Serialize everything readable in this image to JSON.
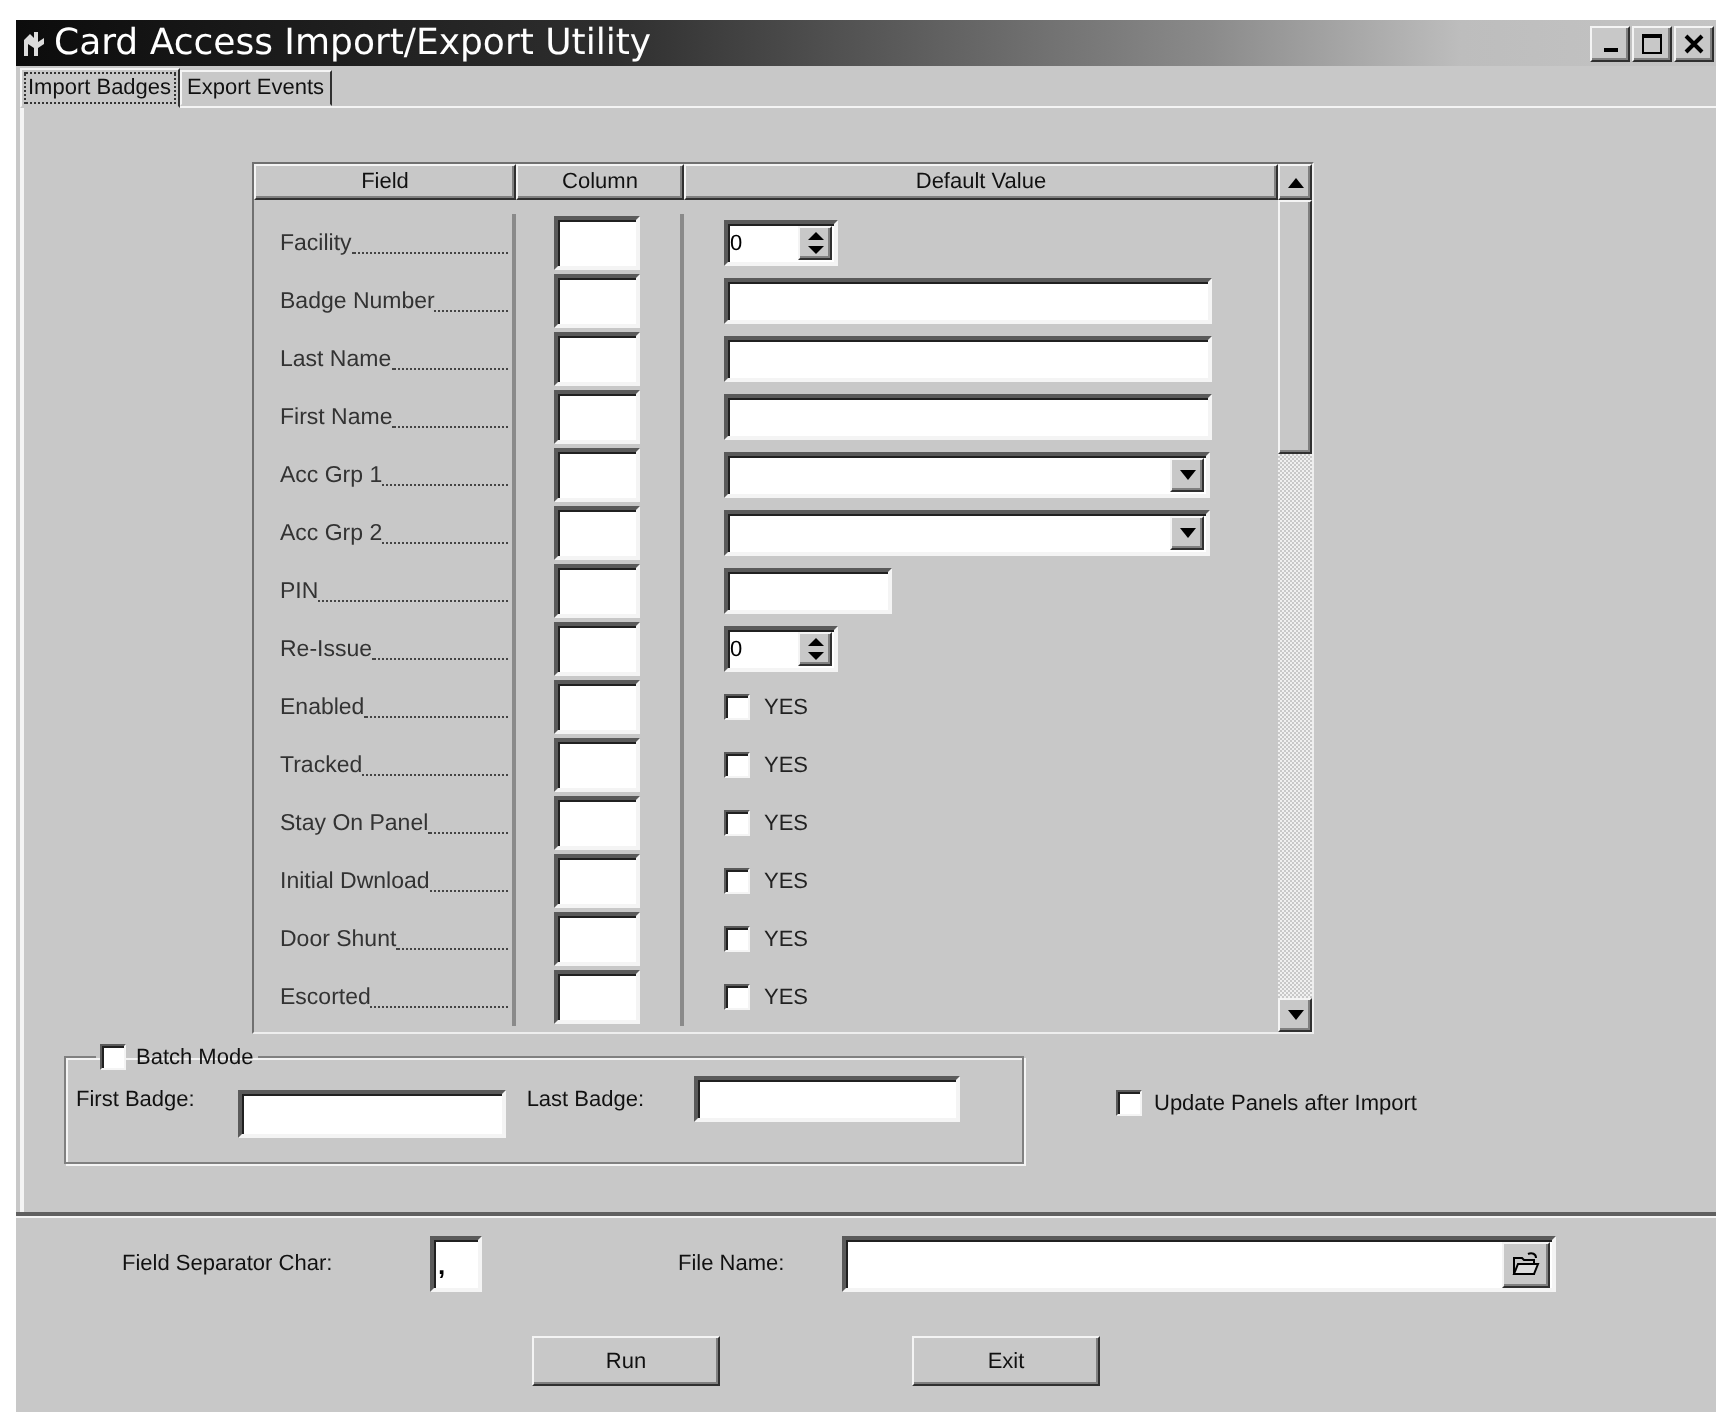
{
  "window": {
    "title": "Card Access Import/Export Utility"
  },
  "tabs": [
    {
      "label": "Import Badges",
      "selected": true
    },
    {
      "label": "Export Events",
      "selected": false
    }
  ],
  "table": {
    "columns": [
      "Field",
      "Column",
      "Default Value"
    ],
    "rows": [
      {
        "field": "Facility",
        "kind": "spinner",
        "value": "0"
      },
      {
        "field": "Badge Number",
        "kind": "text"
      },
      {
        "field": "Last Name",
        "kind": "text"
      },
      {
        "field": "First Name",
        "kind": "text"
      },
      {
        "field": "Acc Grp 1",
        "kind": "dropdown"
      },
      {
        "field": "Acc Grp 2",
        "kind": "dropdown"
      },
      {
        "field": "PIN",
        "kind": "short-text"
      },
      {
        "field": "Re-Issue",
        "kind": "spinner",
        "value": "0"
      },
      {
        "field": "Enabled",
        "kind": "checkbox",
        "label": "YES",
        "checked": false
      },
      {
        "field": "Tracked",
        "kind": "checkbox",
        "label": "YES",
        "checked": false
      },
      {
        "field": "Stay On Panel",
        "kind": "checkbox",
        "label": "YES",
        "checked": false
      },
      {
        "field": "Initial Dwnload",
        "kind": "checkbox",
        "label": "YES",
        "checked": false
      },
      {
        "field": "Door Shunt",
        "kind": "checkbox",
        "label": "YES",
        "checked": false
      },
      {
        "field": "Escorted",
        "kind": "checkbox",
        "label": "YES",
        "checked": false
      }
    ]
  },
  "batch": {
    "label": "Batch Mode",
    "checked": false,
    "first_label": "First Badge:",
    "last_label": "Last Badge:"
  },
  "update_panels": {
    "label": "Update Panels after Import",
    "checked": false
  },
  "separator": {
    "label": "Field Separator Char:",
    "value": ","
  },
  "file_name": {
    "label": "File Name:"
  },
  "buttons": [
    "Run",
    "Exit"
  ]
}
